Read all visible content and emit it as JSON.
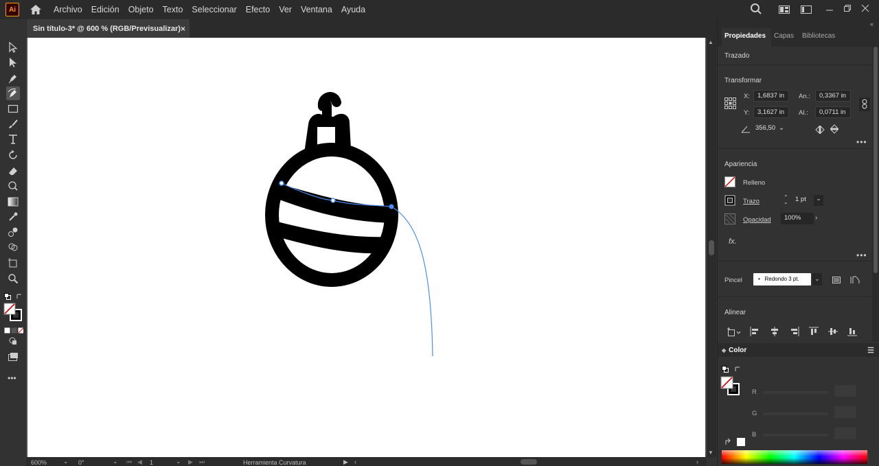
{
  "app": {
    "logo_text": "Ai"
  },
  "menu": [
    "Archivo",
    "Edición",
    "Objeto",
    "Texto",
    "Seleccionar",
    "Efecto",
    "Ver",
    "Ventana",
    "Ayuda"
  ],
  "document_tab": {
    "title": "Sin título-3* @ 600 % (RGB/Previsualizar)",
    "close": "×"
  },
  "panel_tabs": [
    "Propiedades",
    "Capas",
    "Bibliotecas"
  ],
  "properties": {
    "selection_type": "Trazado",
    "transform": {
      "title": "Transformar",
      "x_label": "X:",
      "x_value": "1,6837 in",
      "y_label": "Y:",
      "y_value": "3,1627 in",
      "w_label": "An.:",
      "w_value": "0,3367 in",
      "h_label": "Al.:",
      "h_value": "0,0711 in",
      "angle_value": "356,50"
    },
    "appearance": {
      "title": "Apariencia",
      "fill_label": "Relleno",
      "stroke_label": "Trazo",
      "stroke_value": "1 pt",
      "opacity_label": "Opacidad",
      "opacity_value": "100%",
      "fx_label": "fx."
    },
    "brush": {
      "label": "Pincel",
      "value": "Redondo 3 pt."
    },
    "align": {
      "title": "Alinear"
    }
  },
  "color_panel": {
    "title": "Color",
    "r_label": "R",
    "g_label": "G",
    "b_label": "B",
    "hex_label": "#"
  },
  "status": {
    "zoom": "600%",
    "rotation": "0°",
    "artboard": "1",
    "tool": "Herramienta Curvatura"
  },
  "colors": {
    "accent": "#4b8cf7",
    "ui_dark": "#2b2b2b",
    "panel": "#323232"
  }
}
